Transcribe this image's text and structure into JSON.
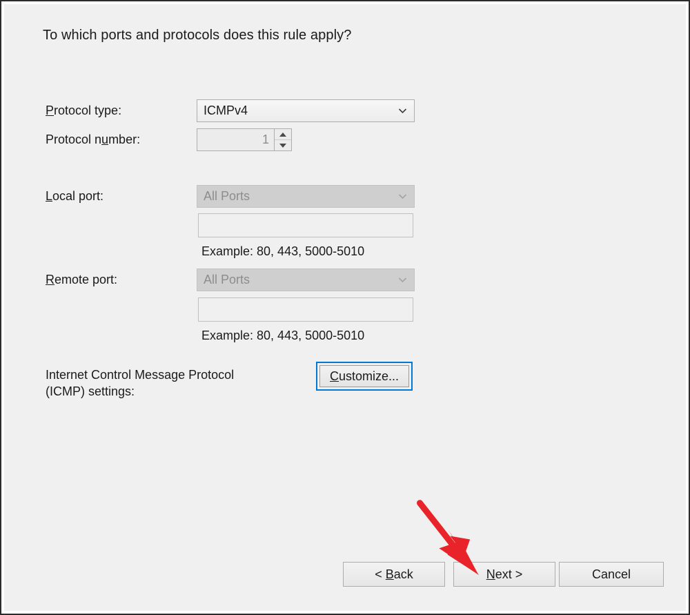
{
  "dialog": {
    "heading": "To which ports and protocols does this rule apply?"
  },
  "form": {
    "protocol_type": {
      "label_pre": "P",
      "label_post": "rotocol type:",
      "value": "ICMPv4",
      "enabled": true
    },
    "protocol_number": {
      "label_pre": "Protocol n",
      "label_accel": "u",
      "label_post": "mber:",
      "value": "1",
      "enabled": false
    },
    "local_port": {
      "label_accel": "L",
      "label_post": "ocal port:",
      "combo_value": "All Ports",
      "text_value": "",
      "example": "Example: 80, 443, 5000-5010",
      "enabled": false
    },
    "remote_port": {
      "label_accel": "R",
      "label_post": "emote port:",
      "combo_value": "All Ports",
      "text_value": "",
      "example": "Example: 80, 443, 5000-5010",
      "enabled": false
    },
    "icmp": {
      "description": "Internet Control Message Protocol\n(ICMP) settings:",
      "button_accel": "C",
      "button_post": "ustomize...",
      "focused": true
    }
  },
  "footer": {
    "back": {
      "prefix": "< ",
      "accel": "B",
      "post": "ack"
    },
    "next": {
      "accel": "N",
      "post": "ext >"
    },
    "cancel": {
      "label": "Cancel"
    }
  },
  "annotation": {
    "arrow_color": "#e8242a",
    "points_to": "next-button"
  }
}
